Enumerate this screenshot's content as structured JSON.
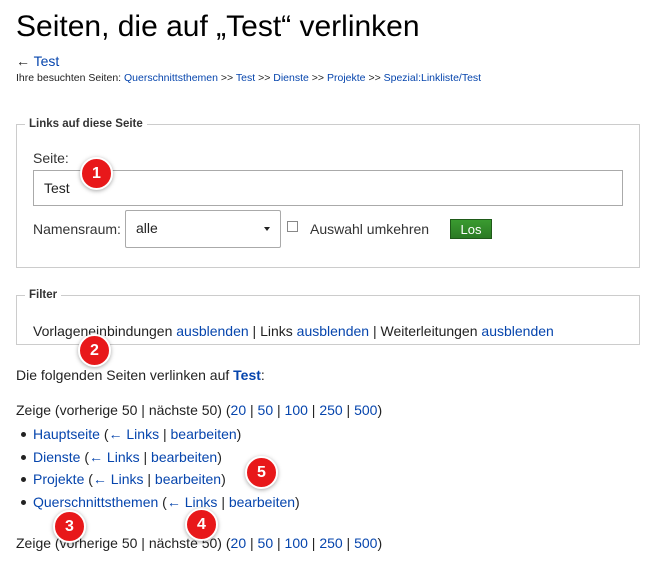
{
  "page": {
    "title": "Seiten, die auf „Test“ verlinken",
    "back_arrow": "←",
    "back_link": "Test",
    "trail_label": "Ihre besuchten Seiten:",
    "trail_sep": ">>",
    "trail": [
      "Querschnittsthemen",
      "Test",
      "Dienste",
      "Projekte",
      "Spezial:Linkliste/Test"
    ]
  },
  "form": {
    "legend": "Links auf diese Seite",
    "page_label": "Seite:",
    "page_value": "Test",
    "namespace_label": "Namensraum:",
    "namespace_value": "alle",
    "invert_label": "Auswahl umkehren",
    "go_label": "Los"
  },
  "filter": {
    "legend": "Filter",
    "templates_label": "Vorlageneinbindungen",
    "links_label": "Links",
    "redirects_label": "Weiterleitungen",
    "hide": "ausblenden",
    "sep": "|"
  },
  "results": {
    "intro_prefix": "Die folgenden Seiten verlinken auf",
    "intro_target": "Test",
    "intro_suffix": ":",
    "show_prefix": "Zeige (vorherige 50 | nächste 50) (",
    "show_suffix": ")",
    "limits": [
      "20",
      "50",
      "100",
      "250",
      "500"
    ],
    "links_text": "← Links",
    "edit_text": "bearbeiten",
    "items": [
      "Hauptseite",
      "Dienste",
      "Projekte",
      "Querschnittsthemen"
    ]
  },
  "annotations": [
    "1",
    "2",
    "3",
    "4",
    "5"
  ]
}
